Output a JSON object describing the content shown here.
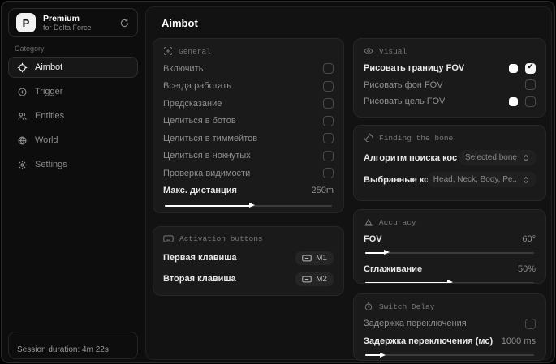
{
  "brand": {
    "logo_letter": "P",
    "title": "Premium",
    "subtitle": "for Delta Force"
  },
  "sidebar": {
    "category_label": "Category",
    "items": [
      {
        "label": "Aimbot"
      },
      {
        "label": "Trigger"
      },
      {
        "label": "Entities"
      },
      {
        "label": "World"
      },
      {
        "label": "Settings"
      }
    ],
    "session": "Session duration: 4m 22s"
  },
  "page_title": "Aimbot",
  "general": {
    "title": "General",
    "rows": [
      {
        "label": "Включить",
        "checked": false
      },
      {
        "label": "Всегда работать",
        "checked": false
      },
      {
        "label": "Предсказание",
        "checked": false
      },
      {
        "label": "Целиться в ботов",
        "checked": false
      },
      {
        "label": "Целиться в тиммейтов",
        "checked": false
      },
      {
        "label": "Целиться в нокнутых",
        "checked": false
      },
      {
        "label": "Проверка видимости",
        "checked": false
      }
    ],
    "max_distance": {
      "label": "Макс. дистанция",
      "value": "250m",
      "fill": 52
    }
  },
  "activation": {
    "title": "Activation buttons",
    "rows": [
      {
        "label": "Первая клавиша",
        "key": "M1"
      },
      {
        "label": "Вторая клавиша",
        "key": "M2"
      }
    ]
  },
  "visual": {
    "title": "Visual",
    "rows": [
      {
        "label": "Рисовать границу FOV",
        "checked": true,
        "swatch": "#ffffff"
      },
      {
        "label": "Рисовать фон FOV",
        "checked": false
      },
      {
        "label": "Рисовать цель FOV",
        "checked": false,
        "swatch": "#ffffff"
      }
    ]
  },
  "bone": {
    "title": "Finding the bone",
    "rows": [
      {
        "label": "Алгоритм поиска кост",
        "value": "Selected bone"
      },
      {
        "label": "Выбранные кос",
        "value": "Head, Neck, Body, Pe.."
      }
    ]
  },
  "accuracy": {
    "title": "Accuracy",
    "sliders": [
      {
        "label": "FOV",
        "value": "60°",
        "fill": 13
      },
      {
        "label": "Сглаживание",
        "value": "50%",
        "fill": 50
      }
    ]
  },
  "switch_delay": {
    "title": "Switch Delay",
    "toggle": {
      "label": "Задержка переключения",
      "checked": false
    },
    "slider": {
      "label": "Задержка переключения (мс)",
      "value": "1000 ms",
      "fill": 11
    }
  },
  "colors": {
    "accent": "#ffffff",
    "card_bg": "#1a1a1a",
    "window_bg": "#0d0d0d",
    "swatch": "#ffffff"
  }
}
